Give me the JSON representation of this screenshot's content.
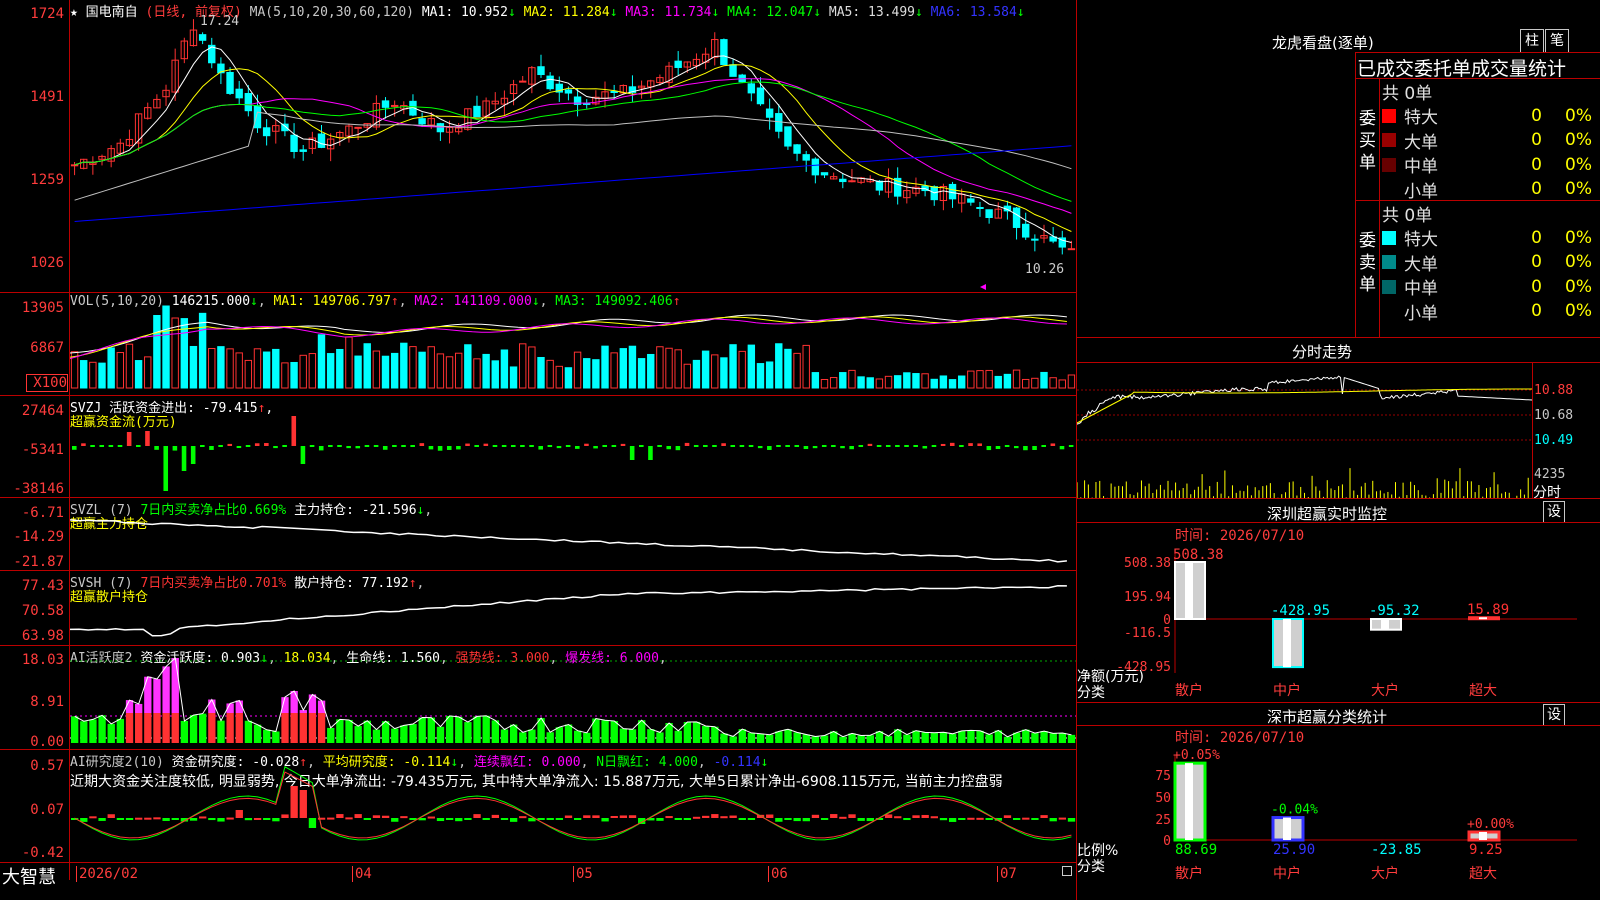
{
  "colors": {
    "up": "#ff3232",
    "down": "#00ffff",
    "ma1": "#ffffff",
    "ma2": "#ffff00",
    "ma3": "#ff00ff",
    "ma4": "#00ff00",
    "ma5": "#c0c0c0",
    "ma6": "#0000ff",
    "grid": "#b00000"
  },
  "header": {
    "star": "★",
    "stock": "国电南自",
    "period": "(日线, 前复权)",
    "ma_params": "MA(5,10,20,30,60,120)",
    "ma": [
      {
        "label": "MA1:",
        "value": "10.952",
        "arr": "↓"
      },
      {
        "label": "MA2:",
        "value": "11.284",
        "arr": "↓"
      },
      {
        "label": "MA3:",
        "value": "11.734",
        "arr": "↓"
      },
      {
        "label": "MA4:",
        "value": "12.047",
        "arr": "↓"
      },
      {
        "label": "MA5:",
        "value": "13.499",
        "arr": "↓"
      },
      {
        "label": "MA6:",
        "value": "13.584",
        "arr": "↓"
      }
    ],
    "high_label": "17.24",
    "low_label": "10.26"
  },
  "price_axis": [
    "1724",
    "1491",
    "1259",
    "1026"
  ],
  "vol": {
    "header": "VOL(5,10,20)",
    "value": "146215.000",
    "arr": "↓",
    "ma1": "MA1: 149706.797",
    "ma1_arr": "↑",
    "ma2": "MA2: 141109.000",
    "ma2_arr": "↓",
    "ma3": "MA3: 149092.406",
    "ma3_arr": "↑",
    "axis": [
      "13905",
      "6867"
    ],
    "unit": "X100"
  },
  "svzj": {
    "header": "SVZJ  活跃资金进出: -79.415",
    "arr": "↑",
    "sub": "超赢资金流(万元)",
    "axis": [
      "27464",
      "-5341",
      "-38146"
    ]
  },
  "svzl": {
    "header": "SVZL (7)",
    "green": "7日内买卖净占比0.669%",
    "white": "主力持仓: -21.596",
    "arr": "↓",
    "sub": "超赢主力持仓",
    "axis": [
      "-6.71",
      "-14.29",
      "-21.87"
    ]
  },
  "svsh": {
    "header": "SVSH (7)",
    "red": "7日内买卖净占比0.701%",
    "white": "散户持仓: 77.192",
    "arr": "↑",
    "sub": "超赢散户持仓",
    "axis": [
      "77.43",
      "70.58",
      "63.98"
    ]
  },
  "ai1": {
    "header": "AI活跃度2",
    "a": "资金活跃度: 0.903",
    "b": "18.034",
    "c": "生命线: 1.560",
    "d": "强势线: 3.000",
    "e": "爆发线: 6.000",
    "axis": [
      "18.03",
      "8.91",
      "0.00"
    ]
  },
  "ai2": {
    "header": "AI研究度2(10)",
    "a": "资金研究度: -0.028",
    "b": "平均研究度: -0.114",
    "c": "连续飘红: 0.000",
    "d": "N日飘红: 4.000",
    "e": "-0.114",
    "comment": "近期大资金关注度较低, 明显弱势, 今日大单净流出: -79.435万元, 其中特大单净流入: 15.887万元, 大单5日累计净出-6908.115万元, 当前主力控盘弱",
    "axis": [
      "0.57",
      "0.07",
      "-0.42"
    ]
  },
  "date_axis": {
    "app": "大智慧",
    "labels": [
      "2026/02",
      "04",
      "05",
      "06",
      "07"
    ]
  },
  "dragon": {
    "title": "龙虎看盘(逐单)",
    "btn1": "柱",
    "btn2": "笔",
    "subtitle": "已成交委托单成交量统计",
    "buy_label": "委买单",
    "sell_label": "委卖单",
    "buy": {
      "total": "共 0单",
      "rows": [
        {
          "name": "特大",
          "v": "0",
          "p": "0%",
          "c": "#ff0000"
        },
        {
          "name": "大单",
          "v": "0",
          "p": "0%",
          "c": "#990000"
        },
        {
          "name": "中单",
          "v": "0",
          "p": "0%",
          "c": "#660000"
        },
        {
          "name": "小单",
          "v": "0",
          "p": "0%",
          "c": ""
        }
      ]
    },
    "sell": {
      "total": "共 0单",
      "rows": [
        {
          "name": "特大",
          "v": "0",
          "p": "0%",
          "c": "#00ffff"
        },
        {
          "name": "大单",
          "v": "0",
          "p": "0%",
          "c": "#008b8b"
        },
        {
          "name": "中单",
          "v": "0",
          "p": "0%",
          "c": "#006666"
        },
        {
          "name": "小单",
          "v": "0",
          "p": "0%",
          "c": ""
        }
      ]
    }
  },
  "intraday": {
    "title": "分时走势",
    "axis": [
      "10.88",
      "10.68",
      "10.49"
    ],
    "vol": "4235",
    "unit": "分时"
  },
  "monitor": {
    "title": "深圳超赢实时监控",
    "btn": "设",
    "time": "时间: 2026/07/10",
    "axis": [
      "508.38",
      "195.94",
      "0",
      "-116.5",
      "-428.95"
    ],
    "ylabel": "净额(万元)",
    "xlabel": "分类",
    "cats": [
      "散户",
      "中户",
      "大户",
      "超大"
    ],
    "values": [
      "508.38",
      "-428.95",
      "-95.32",
      "15.89"
    ]
  },
  "classify": {
    "title": "深市超赢分类统计",
    "btn": "设",
    "time": "时间: 2026/07/10",
    "axis": [
      "75",
      "50",
      "25",
      "0"
    ],
    "ylabel": "比例%",
    "xlabel": "分类",
    "cats": [
      "散户",
      "中户",
      "大户",
      "超大"
    ],
    "top": [
      "+0.05%",
      "-0.04%",
      "",
      "+0.00%"
    ],
    "bottom": [
      "88.69",
      "25.90",
      "-23.85",
      "9.25"
    ]
  },
  "chart_data": {
    "type": "bar",
    "categories": [
      "散户",
      "中户",
      "大户",
      "超大"
    ],
    "values": [
      508.38,
      -428.95,
      -95.32,
      15.89
    ],
    "title": "深圳超赢实时监控",
    "ylabel": "净额(万元)"
  }
}
